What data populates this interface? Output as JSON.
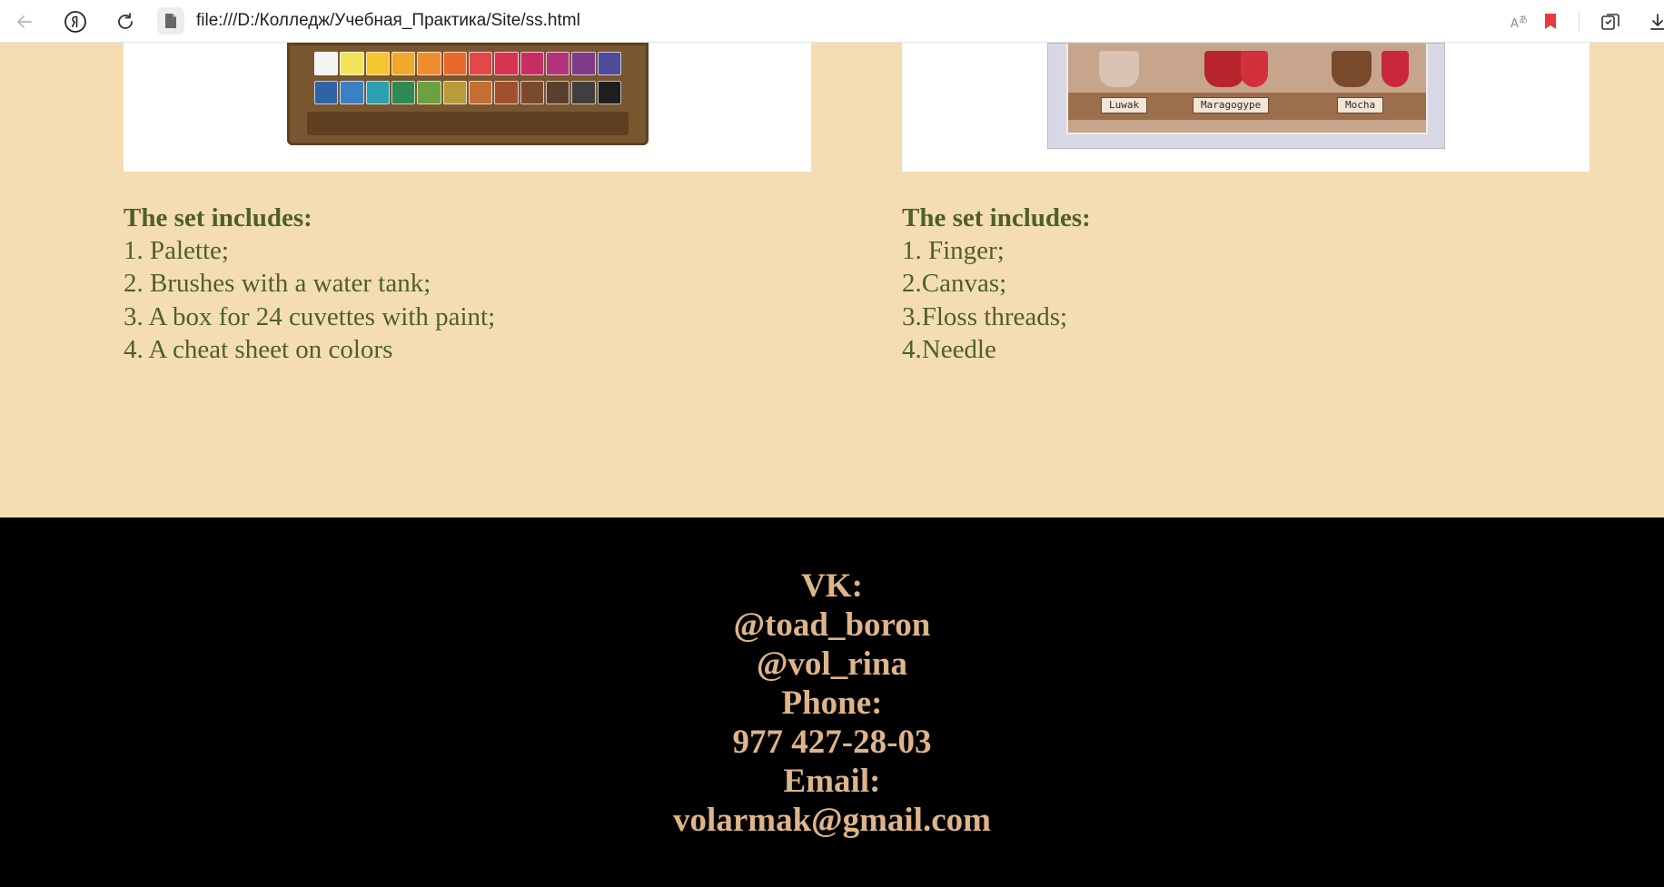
{
  "browser": {
    "url": "file:///D:/Колледж/Учебная_Практика/Site/ss.html"
  },
  "products": [
    {
      "includes_title": "The set includes:",
      "items": [
        "1. Palette;",
        "2. Brushes with a water tank;",
        "3. A box for 24 cuvettes with paint;",
        "4. A cheat sheet on colors"
      ]
    },
    {
      "includes_title": "The set includes:",
      "items": [
        "1. Finger;",
        "2.Canvas;",
        "3.Floss threads;",
        "4.Needle"
      ],
      "image_tags": [
        "Luwak",
        "Maragogype",
        "Mocha"
      ]
    }
  ],
  "footer": {
    "vk_label": "VK:",
    "vk_handles": [
      "@toad_boron",
      "@vol_rina"
    ],
    "phone_label": "Phone:",
    "phone": "977 427-28-03",
    "email_label": "Email:",
    "email": "volarmak@gmail.com"
  },
  "colors": {
    "page_bg": "#f4ddb3",
    "text_green": "#4f5f2b",
    "footer_bg": "#000000",
    "footer_text": "#deb48a"
  },
  "icons": [
    "back-arrow-icon",
    "yandex-icon",
    "reload-icon",
    "file-icon",
    "translate-icon",
    "bookmark-icon",
    "collections-icon",
    "download-icon"
  ]
}
